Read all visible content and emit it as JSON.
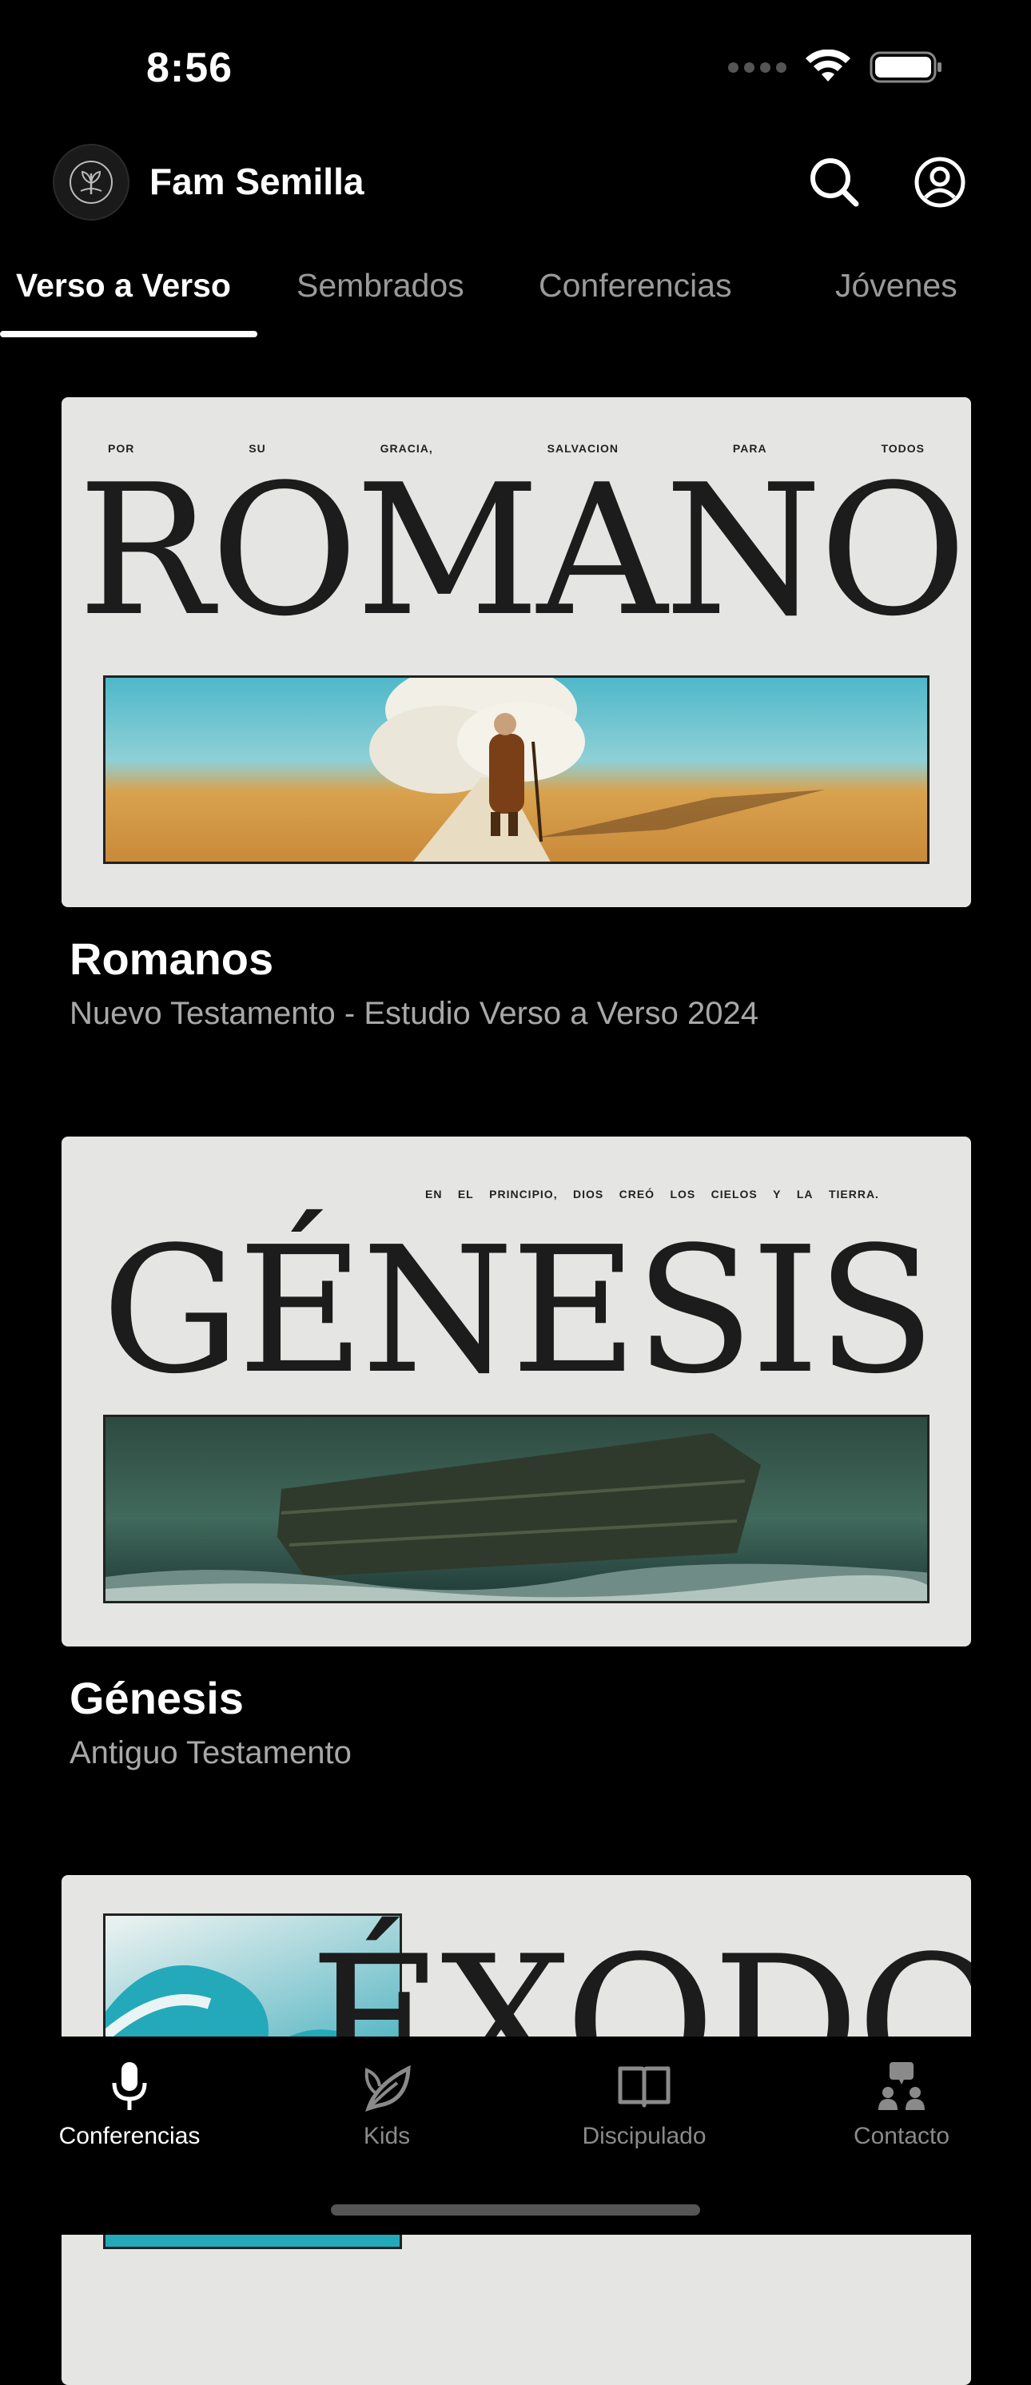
{
  "status_bar": {
    "time": "8:56"
  },
  "header": {
    "title": "Fam Semilla"
  },
  "tabs": [
    {
      "label": "Verso a Verso",
      "active": true
    },
    {
      "label": "Sembrados",
      "active": false
    },
    {
      "label": "Conferencias",
      "active": false
    },
    {
      "label": "Jóvenes",
      "active": false
    }
  ],
  "series": [
    {
      "title": "Romanos",
      "subtitle": "Nuevo Testamento - Estudio Verso a Verso 2024",
      "art": {
        "word": "ROMANOS",
        "tagline": [
          "POR",
          "SU",
          "GRACIA,",
          "SALVACION",
          "PARA",
          "TODOS"
        ]
      }
    },
    {
      "title": "Génesis",
      "subtitle": "Antiguo Testamento",
      "art": {
        "word": "GÉNESIS",
        "tagline": [
          "EN",
          "EL",
          "PRINCIPIO,",
          "DIOS",
          "CREÓ",
          "LOS",
          "CIELOS",
          "Y",
          "LA",
          "TIERRA."
        ]
      }
    },
    {
      "art": {
        "word": "ÉXODO"
      }
    }
  ],
  "bottom_nav": [
    {
      "label": "Conferencias",
      "icon": "microphone-icon",
      "active": true
    },
    {
      "label": "Kids",
      "icon": "sprout-icon",
      "active": false
    },
    {
      "label": "Discipulado",
      "icon": "book-icon",
      "active": false
    },
    {
      "label": "Contacto",
      "icon": "contact-icon",
      "active": false
    }
  ],
  "colors": {
    "background": "#000000",
    "active": "#ffffff",
    "inactive": "#8a8a8a",
    "card": "#e5e5e3"
  }
}
